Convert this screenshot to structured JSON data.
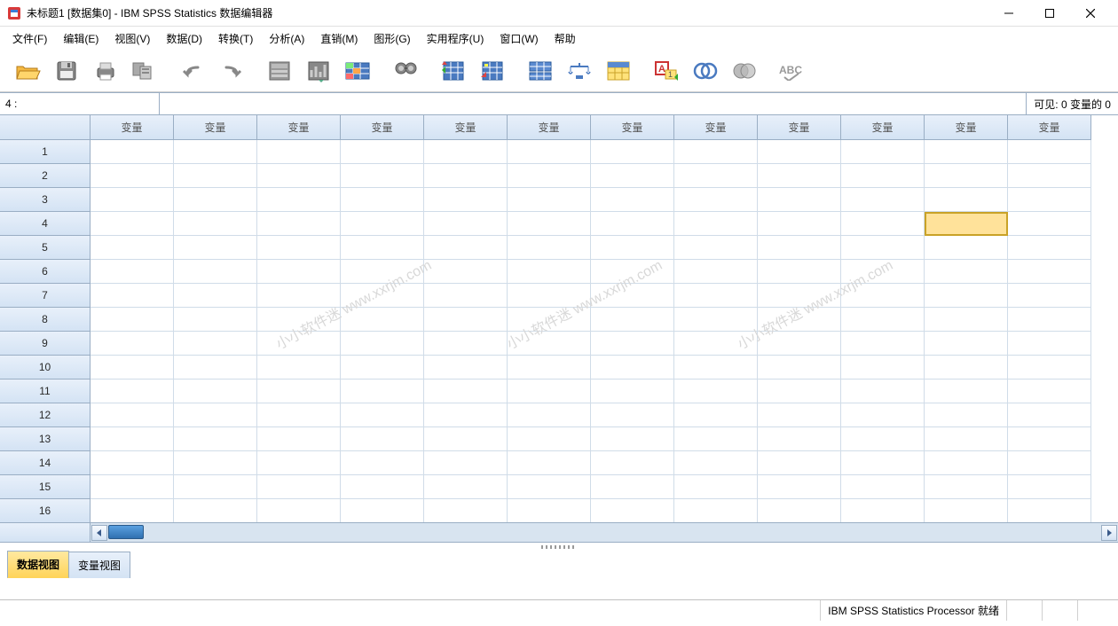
{
  "window": {
    "title": "未标题1 [数据集0] - IBM SPSS Statistics 数据编辑器"
  },
  "menu": {
    "file": "文件(F)",
    "edit": "编辑(E)",
    "view": "视图(V)",
    "data": "数据(D)",
    "transform": "转换(T)",
    "analyze": "分析(A)",
    "direct": "直销(M)",
    "graphs": "图形(G)",
    "utilities": "实用程序(U)",
    "window": "窗口(W)",
    "help": "帮助"
  },
  "toolbar_icons": {
    "open": "open-file-icon",
    "save": "save-icon",
    "print": "print-icon",
    "recall": "recall-dialog-icon",
    "undo": "undo-icon",
    "redo": "redo-icon",
    "goto_case": "goto-case-icon",
    "goto_var": "goto-variable-icon",
    "variables": "variables-icon",
    "find": "find-icon",
    "insert_case": "insert-case-icon",
    "insert_var": "insert-variable-icon",
    "split": "split-file-icon",
    "weight": "weight-cases-icon",
    "select": "select-cases-icon",
    "value_labels": "value-labels-icon",
    "use_sets": "use-sets-icon",
    "show_all": "show-all-icon",
    "spell": "spellcheck-icon"
  },
  "cellbar": {
    "ref": "4 :",
    "value": "",
    "visible_label": "可见:",
    "visible_value": "0 变量的 0"
  },
  "grid": {
    "col_header": "变量",
    "num_cols": 12,
    "row_count": 16,
    "selected": {
      "row": 4,
      "col": 11
    }
  },
  "watermark": {
    "line1": "小小软件迷 www.xxrjm.com"
  },
  "tabs": {
    "data_view": "数据视图",
    "var_view": "变量视图"
  },
  "status": {
    "processor": "IBM SPSS Statistics Processor 就绪"
  }
}
